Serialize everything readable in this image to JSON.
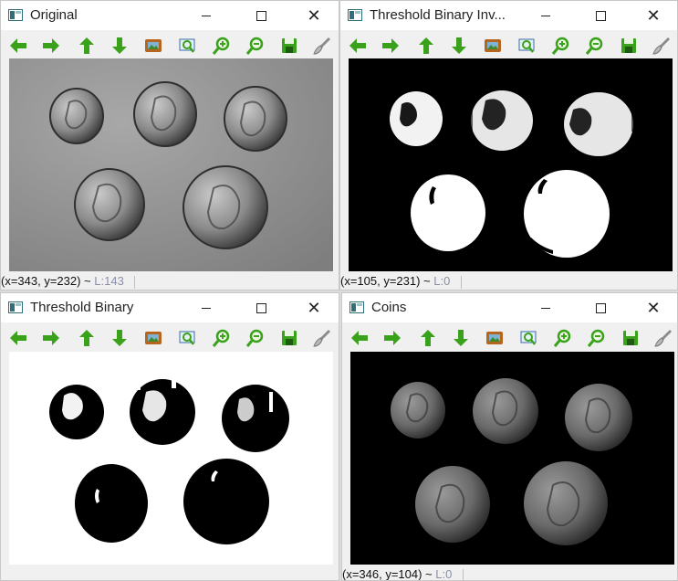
{
  "windows": [
    {
      "id": "original",
      "title": "Original",
      "status": {
        "coords": "(x=343, y=232) ~",
        "pixel": "L:143"
      }
    },
    {
      "id": "inv",
      "title": "Threshold Binary Inv...",
      "status": {
        "coords": "(x=105, y=231) ~",
        "pixel": "L:0"
      }
    },
    {
      "id": "bin",
      "title": "Threshold Binary",
      "status": {
        "coords": "",
        "pixel": ""
      }
    },
    {
      "id": "coins",
      "title": "Coins",
      "status": {
        "coords": "(x=346, y=104) ~",
        "pixel": "L:0"
      }
    }
  ],
  "window_controls": {
    "close_glyph": "✕"
  },
  "toolbar_icons": [
    "pan-left-icon",
    "pan-right-icon",
    "pan-up-icon",
    "pan-down-icon",
    "save-image-icon",
    "zoom-window-icon",
    "zoom-in-icon",
    "zoom-out-icon",
    "save-icon",
    "properties-brush-icon"
  ],
  "colors": {
    "arrow_green": "#3aa21a",
    "image_black": "#000000",
    "image_white": "#ffffff",
    "gray_background": "#8c8c8c",
    "coin_gray": "#707070"
  }
}
